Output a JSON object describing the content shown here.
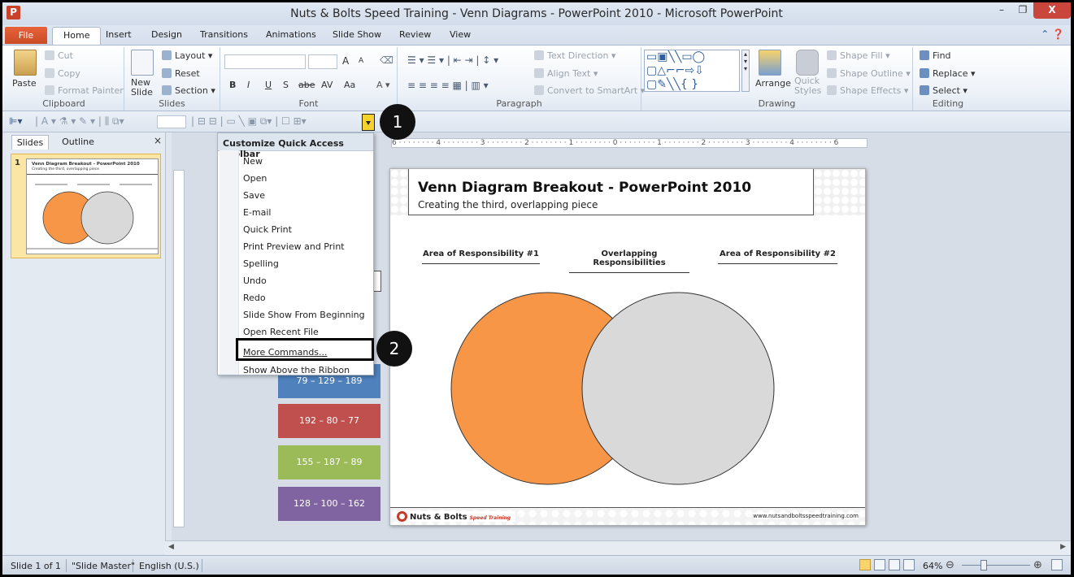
{
  "window": {
    "title": "Nuts & Bolts Speed Training - Venn Diagrams - PowerPoint 2010  -  Microsoft PowerPoint",
    "app_icon": "P",
    "controls": {
      "minimize": "–",
      "maximize": "❐",
      "close": "X"
    }
  },
  "tabs": {
    "file": "File",
    "items": [
      "Home",
      "Insert",
      "Design",
      "Transitions",
      "Animations",
      "Slide Show",
      "Review",
      "View"
    ],
    "active": "Home"
  },
  "ribbon": {
    "clipboard": {
      "label": "Clipboard",
      "paste": "Paste",
      "cut": "Cut",
      "copy": "Copy",
      "format_painter": "Format Painter"
    },
    "slides": {
      "label": "Slides",
      "new_slide": "New Slide",
      "layout": "Layout",
      "reset": "Reset",
      "section": "Section"
    },
    "font": {
      "label": "Font",
      "bold": "B",
      "italic": "I",
      "underline": "U",
      "shadow": "S",
      "strike": "abe",
      "spacing": "AV",
      "case": "Aa",
      "grow": "A",
      "shrink": "A"
    },
    "paragraph": {
      "label": "Paragraph",
      "text_direction": "Text Direction",
      "align_text": "Align Text",
      "convert_smartart": "Convert to SmartArt"
    },
    "drawing": {
      "label": "Drawing",
      "arrange": "Arrange",
      "quick_styles": "Quick Styles",
      "shape_fill": "Shape Fill",
      "shape_outline": "Shape Outline",
      "shape_effects": "Shape Effects"
    },
    "editing": {
      "label": "Editing",
      "find": "Find",
      "replace": "Replace",
      "select": "Select"
    }
  },
  "qat_menu": {
    "header": "Customize Quick Access Toolbar",
    "items": [
      "New",
      "Open",
      "Save",
      "E-mail",
      "Quick Print",
      "Print Preview and Print",
      "Spelling",
      "Undo",
      "Redo",
      "Slide Show From Beginning",
      "Open Recent File",
      "More Commands...",
      "Show Above the Ribbon"
    ]
  },
  "callouts": {
    "one": "1",
    "two": "2"
  },
  "panel": {
    "tab_slides": "Slides",
    "tab_outline": "Outline",
    "close": "×",
    "slide_number": "1"
  },
  "thumbnail": {
    "title": "Venn Diagram Breakout - PowerPoint 2010",
    "subtitle": "Creating the third, overlapping piece"
  },
  "swatches": [
    {
      "label": "79 – 129 – 189",
      "color": "#4f81bd"
    },
    {
      "label": "192 – 80 – 77",
      "color": "#c0504d"
    },
    {
      "label": "155 – 187 – 89",
      "color": "#9bbb59"
    },
    {
      "label": "128 – 100 – 162",
      "color": "#8064a2"
    }
  ],
  "ruler": {
    "horizontal": "6 · · · · · · · · 4 · · · · · · · · 3 · · · · · · · · 2 · · · · · · · · 1 · · · · · · · · 0 · · · · · · · · 1 · · · · · · · · 2 · · · · · · · · 3 · · · · · · · · 4 · · · · · · · · 6"
  },
  "slide": {
    "title": "Venn Diagram Breakout - PowerPoint 2010",
    "subtitle": "Creating the third, overlapping piece",
    "col1": "Area of Responsibility #1",
    "col2": "Overlapping Responsibilities",
    "col3": "Area of Responsibility #2",
    "circle_left_color": "#f79646",
    "circle_right_color": "#d9d9d9",
    "logo": "Nuts & Bolts",
    "logo_tag": "Speed Training",
    "website": "www.nutsandboltsspeedtraining.com"
  },
  "status": {
    "slide": "Slide 1 of 1",
    "theme": "\"Slide Master\"",
    "language": "English (U.S.)",
    "zoom": "64%"
  }
}
